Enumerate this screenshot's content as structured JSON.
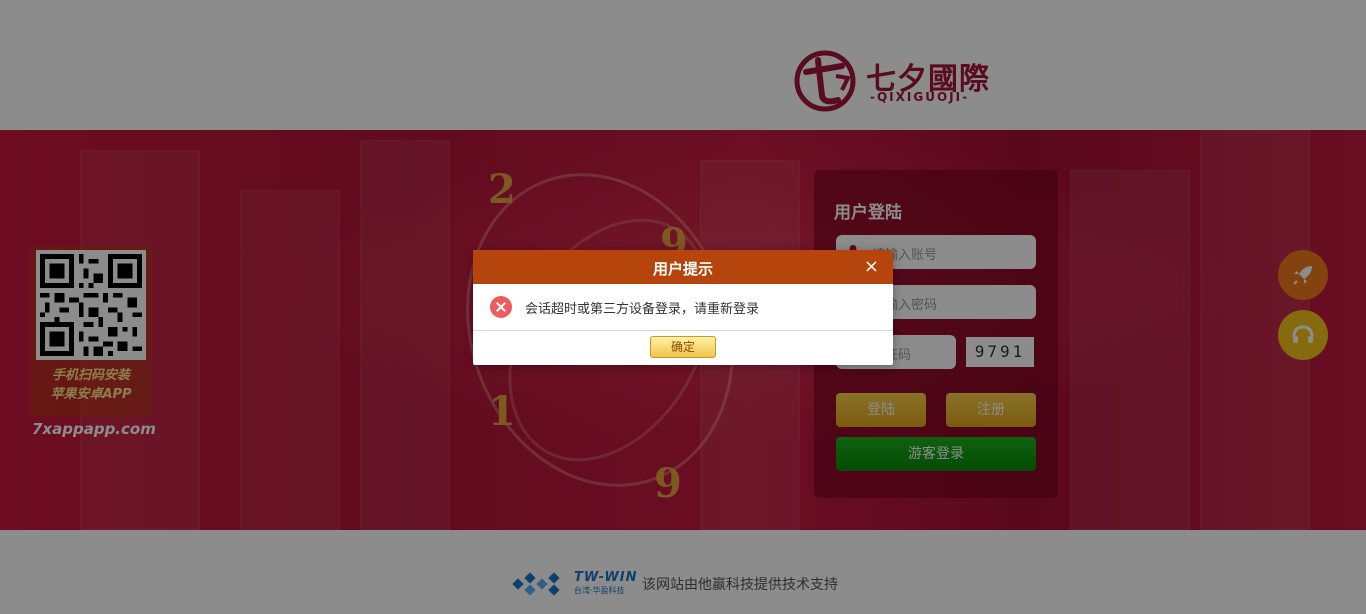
{
  "brand": {
    "name": "七夕國際",
    "sub": "-QIXIGUOJI-"
  },
  "qr": {
    "caption_line1": "手机扫码安装",
    "caption_line2": "苹果安卓APP",
    "url": "7xappapp.com"
  },
  "banner_numbers": [
    "2",
    "9",
    "1",
    "9"
  ],
  "login": {
    "title": "用户登陆",
    "username_placeholder": "请输入账号",
    "password_placeholder": "请输入密码",
    "captcha_placeholder": "验证码",
    "captcha_code": "9791",
    "login_button": "登陆",
    "register_button": "注册",
    "guest_button": "游客登录"
  },
  "side_buttons": {
    "rocket_icon": "rocket-icon",
    "support_icon": "support-icon"
  },
  "footer": {
    "partner_logo": "TW-WIN",
    "partner_sub": "台湾·华盈科技",
    "text": "该网站由他赢科技提供技术支持"
  },
  "dialog": {
    "title": "用户提示",
    "close": "×",
    "message": "会话超时或第三方设备登录，请重新登录",
    "ok_button": "确定"
  },
  "colors": {
    "brand": "#a0143c",
    "dialog_header": "#b5450c",
    "button_gold": "#e2a41c",
    "button_green": "#0a8a0a"
  }
}
